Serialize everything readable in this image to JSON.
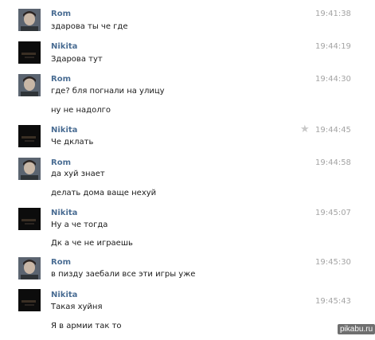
{
  "messages": [
    {
      "author": "Rom",
      "time": "19:41:38",
      "lines": [
        "здарова ты че где"
      ],
      "avatar": "rom-avatar",
      "starred": false
    },
    {
      "author": "Nikita",
      "time": "19:44:19",
      "lines": [
        "Здарова тут"
      ],
      "avatar": "nikita-avatar",
      "starred": false
    },
    {
      "author": "Rom",
      "time": "19:44:30",
      "lines": [
        "где? бля погнали на улицу",
        "ну не надолго"
      ],
      "avatar": "rom-avatar",
      "starred": false
    },
    {
      "author": "Nikita",
      "time": "19:44:45",
      "lines": [
        "Че дклать"
      ],
      "avatar": "nikita-avatar",
      "starred": true
    },
    {
      "author": "Rom",
      "time": "19:44:58",
      "lines": [
        "да хуй знает",
        "делать дома ваще нехуй"
      ],
      "avatar": "rom-avatar",
      "starred": false
    },
    {
      "author": "Nikita",
      "time": "19:45:07",
      "lines": [
        "Ну а че тогда",
        "Дк а че не играешь"
      ],
      "avatar": "nikita-avatar",
      "starred": false
    },
    {
      "author": "Rom",
      "time": "19:45:30",
      "lines": [
        "в пизду заебали все эти игры уже"
      ],
      "avatar": "rom-avatar",
      "starred": false
    },
    {
      "author": "Nikita",
      "time": "19:45:43",
      "lines": [
        "Такая хуйня",
        "Я в армии так то"
      ],
      "avatar": "nikita-avatar",
      "starred": false
    }
  ],
  "icons": {
    "star": "star-icon"
  },
  "watermark": "pikabu.ru",
  "colors": {
    "author": "#4a6d93",
    "time": "#a4a4a4",
    "text": "#1a1a1a",
    "star": "#c8c8c8"
  }
}
